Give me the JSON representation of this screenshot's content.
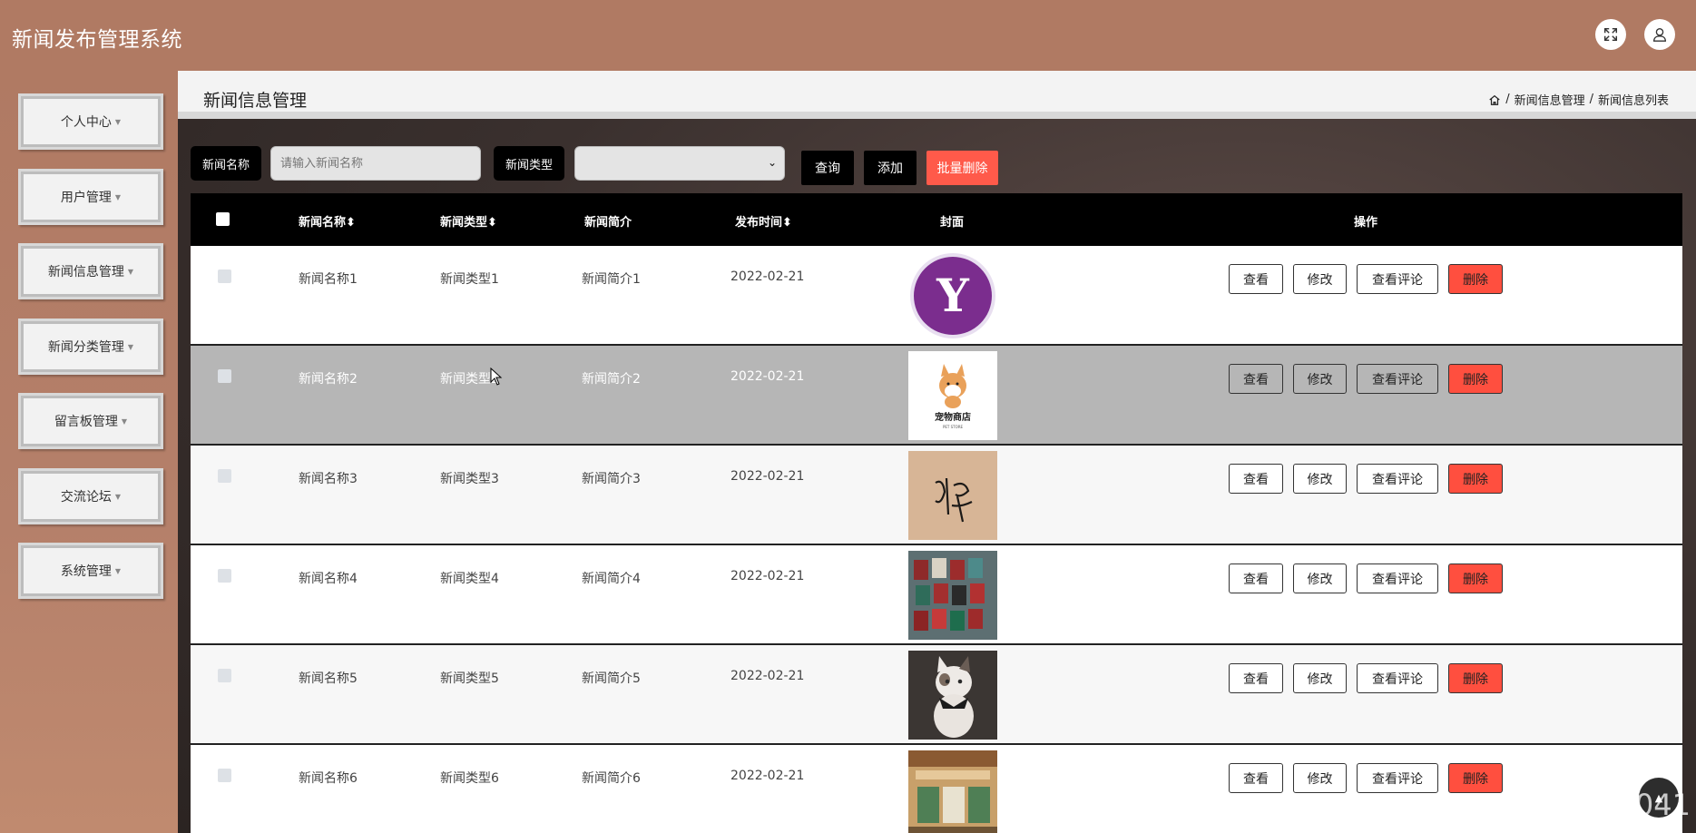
{
  "app": {
    "title": "新闻发布管理系统"
  },
  "sidebar": {
    "items": [
      {
        "label": "个人中心"
      },
      {
        "label": "用户管理"
      },
      {
        "label": "新闻信息管理"
      },
      {
        "label": "新闻分类管理"
      },
      {
        "label": "留言板管理"
      },
      {
        "label": "交流论坛"
      },
      {
        "label": "系统管理"
      }
    ]
  },
  "page": {
    "title": "新闻信息管理",
    "breadcrumb": [
      "新闻信息管理",
      "新闻信息列表"
    ]
  },
  "search": {
    "name_label": "新闻名称",
    "name_placeholder": "请输入新闻名称",
    "type_label": "新闻类型",
    "type_value": "",
    "query_btn": "查询",
    "add_btn": "添加",
    "batch_delete_btn": "批量删除"
  },
  "table": {
    "headers": [
      "新闻名称",
      "新闻类型",
      "新闻简介",
      "发布时间",
      "封面",
      "操作"
    ],
    "rows": [
      {
        "name": "新闻名称1",
        "type": "新闻类型1",
        "intro": "新闻简介1",
        "date": "2022-02-21",
        "cover": "logo-y"
      },
      {
        "name": "新闻名称2",
        "type": "新闻类型2",
        "intro": "新闻简介2",
        "date": "2022-02-21",
        "cover": "pet-store"
      },
      {
        "name": "新闻名称3",
        "type": "新闻类型3",
        "intro": "新闻简介3",
        "date": "2022-02-21",
        "cover": "calligraphy"
      },
      {
        "name": "新闻名称4",
        "type": "新闻类型4",
        "intro": "新闻简介4",
        "date": "2022-02-21",
        "cover": "books"
      },
      {
        "name": "新闻名称5",
        "type": "新闻类型5",
        "intro": "新闻简介5",
        "date": "2022-02-21",
        "cover": "cat"
      },
      {
        "name": "新闻名称6",
        "type": "新闻类型6",
        "intro": "新闻简介6",
        "date": "2022-02-21",
        "cover": "store"
      }
    ],
    "actions": {
      "view": "查看",
      "edit": "修改",
      "comments": "查看评论",
      "delete": "删除"
    }
  },
  "cover_texts": {
    "logo_letter": "Y",
    "pet_store": "宠物商店",
    "pet_store_en": "PET STORE"
  },
  "watermark": "CSDN @CK3041",
  "colors": {
    "header_bg": "#b07a63",
    "accent_red": "#ff5a4a",
    "dark": "#000000"
  }
}
